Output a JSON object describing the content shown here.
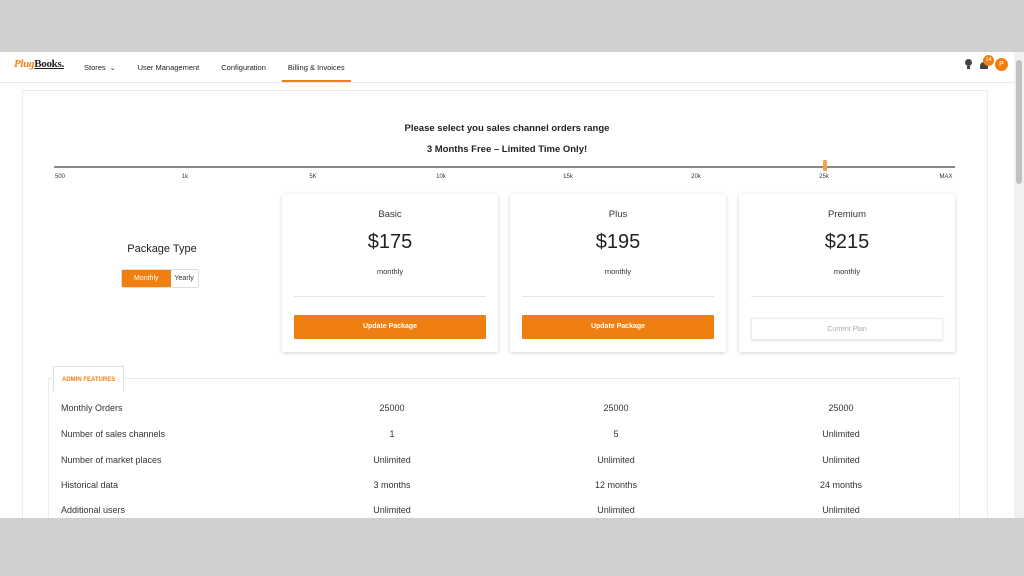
{
  "app": {
    "logo_part_a": "Plug",
    "logo_part_b": "Books."
  },
  "nav": {
    "items": [
      {
        "label": "Stores",
        "has_dropdown": true
      },
      {
        "label": "User Management"
      },
      {
        "label": "Configuration"
      },
      {
        "label": "Billing & Invoices",
        "active": true
      }
    ]
  },
  "header_icons": {
    "notification_count": "14",
    "avatar_initial": "P"
  },
  "range": {
    "title": "Please select you sales channel orders range",
    "promo": "3 Months Free – Limited Time Only!",
    "ticks": [
      "500",
      "1k",
      "5K",
      "10k",
      "15k",
      "20k",
      "25k",
      "MAX"
    ],
    "selected": "25k"
  },
  "package_type": {
    "label": "Package Type",
    "options": [
      "Monthly",
      "Yearly"
    ],
    "selected": "Monthly"
  },
  "plans": [
    {
      "name": "Basic",
      "price": "$175",
      "period": "monthly",
      "action": "Update Package"
    },
    {
      "name": "Plus",
      "price": "$195",
      "period": "monthly",
      "action": "Update Package"
    },
    {
      "name": "Premium",
      "price": "$215",
      "period": "monthly",
      "action": "Current Plan"
    }
  ],
  "features": {
    "tab_label": "ADMIN FEATURES",
    "rows": [
      {
        "label": "Monthly Orders",
        "values": [
          "25000",
          "25000",
          "25000"
        ]
      },
      {
        "label": "Number of sales channels",
        "values": [
          "1",
          "5",
          "Unlimited"
        ]
      },
      {
        "label": "Number of market places",
        "values": [
          "Unlimited",
          "Unlimited",
          "Unlimited"
        ]
      },
      {
        "label": "Historical data",
        "values": [
          "3 months",
          "12 months",
          "24 months"
        ]
      },
      {
        "label": "Additional users",
        "values": [
          "Unlimited",
          "Unlimited",
          "Unlimited"
        ]
      }
    ]
  },
  "colors": {
    "accent": "#f07f12"
  }
}
